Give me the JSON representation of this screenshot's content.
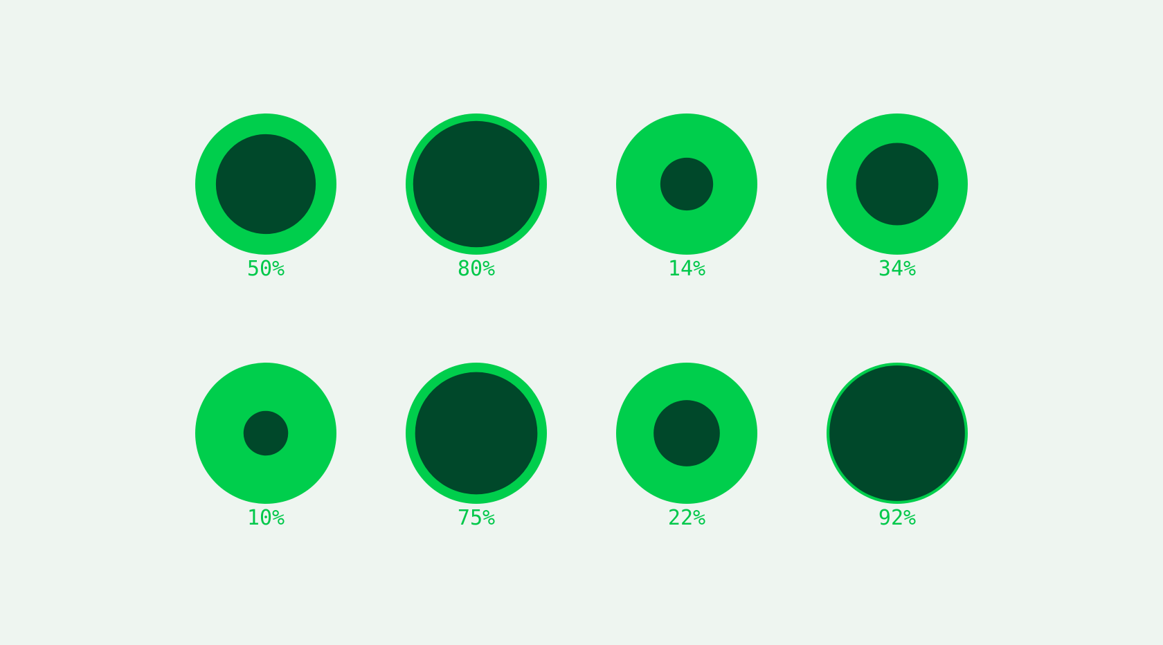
{
  "chart_data": {
    "type": "proportional-circle-grid",
    "max_value": 100,
    "inner_size_encoding": "area",
    "colors": {
      "background": "#EEF5F0",
      "outer": "#00CE4C",
      "inner": "#00482A",
      "label": "#00C84A"
    },
    "items": [
      {
        "label": "50%",
        "value": 50
      },
      {
        "label": "80%",
        "value": 80
      },
      {
        "label": "14%",
        "value": 14
      },
      {
        "label": "34%",
        "value": 34
      },
      {
        "label": "10%",
        "value": 10
      },
      {
        "label": "75%",
        "value": 75
      },
      {
        "label": "22%",
        "value": 22
      },
      {
        "label": "92%",
        "value": 92
      }
    ]
  }
}
